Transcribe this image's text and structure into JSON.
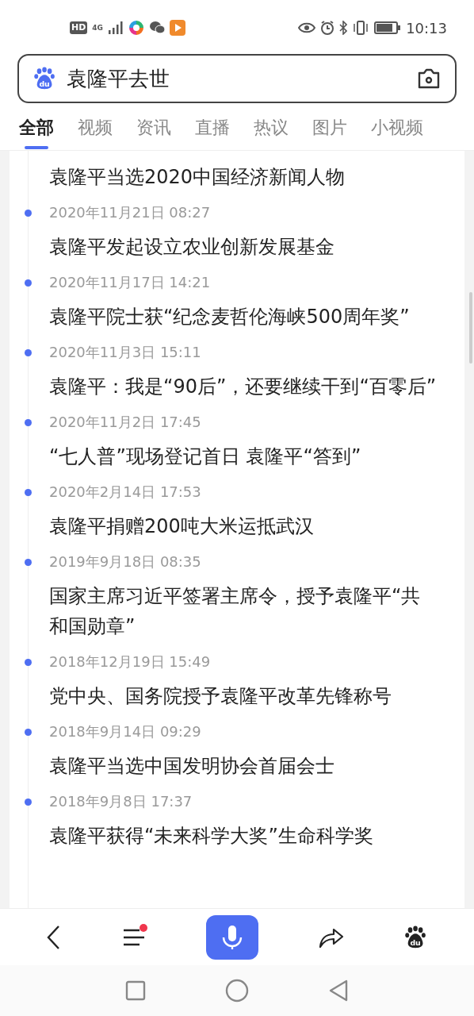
{
  "status_bar": {
    "time": "10:13",
    "badge": "HD",
    "network": "4G"
  },
  "search": {
    "logo_text": "du",
    "value": "袁隆平去世"
  },
  "tabs": [
    {
      "label": "全部",
      "selected": true
    },
    {
      "label": "视频",
      "selected": false
    },
    {
      "label": "资讯",
      "selected": false
    },
    {
      "label": "直播",
      "selected": false
    },
    {
      "label": "热议",
      "selected": false
    },
    {
      "label": "图片",
      "selected": false
    },
    {
      "label": "小视频",
      "selected": false
    }
  ],
  "timeline": [
    {
      "title": "袁隆平当选2020中国经济新闻人物"
    },
    {
      "date": "2020年11月21日 08:27",
      "title": "袁隆平发起设立农业创新发展基金"
    },
    {
      "date": "2020年11月17日 14:21",
      "title": "袁隆平院士获“纪念麦哲伦海峡500周年奖”"
    },
    {
      "date": "2020年11月3日 15:11",
      "title": "袁隆平：我是“90后”，还要继续干到“百零后”"
    },
    {
      "date": "2020年11月2日 17:45",
      "title": "“七人普”现场登记首日 袁隆平“答到”"
    },
    {
      "date": "2020年2月14日 17:53",
      "title": "袁隆平捐赠200吨大米运抵武汉"
    },
    {
      "date": "2019年9月18日 08:35",
      "title": "国家主席习近平签署主席令，授予袁隆平“共和国勋章”"
    },
    {
      "date": "2018年12月19日 15:49",
      "title": "党中央、国务院授予袁隆平改革先锋称号"
    },
    {
      "date": "2018年9月14日 09:29",
      "title": "袁隆平当选中国发明协会首届会士"
    },
    {
      "date": "2018年9月8日 17:37",
      "title": "袁隆平获得“未来科学大奖”生命科学奖"
    }
  ],
  "bottom_nav": {
    "menu_unread": true,
    "logo_text": "du"
  }
}
